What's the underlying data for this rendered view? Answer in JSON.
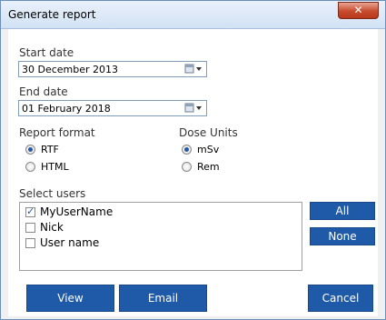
{
  "window": {
    "title": "Generate report",
    "close_icon": "close-icon"
  },
  "start_date": {
    "label": "Start date",
    "value": "30 December 2013"
  },
  "end_date": {
    "label": "End date",
    "value": "01  February  2018"
  },
  "report_format": {
    "label": "Report format",
    "options": [
      {
        "label": "RTF",
        "selected": true
      },
      {
        "label": "HTML",
        "selected": false
      }
    ]
  },
  "dose_units": {
    "label": "Dose Units",
    "options": [
      {
        "label": "mSv",
        "selected": true
      },
      {
        "label": "Rem",
        "selected": false
      }
    ]
  },
  "select_users": {
    "label": "Select users",
    "users": [
      {
        "name": "MyUserName",
        "checked": true
      },
      {
        "name": "Nick",
        "checked": false
      },
      {
        "name": "User name",
        "checked": false
      }
    ],
    "all_label": "All",
    "none_label": "None"
  },
  "actions": {
    "view_label": "View",
    "email_label": "Email",
    "cancel_label": "Cancel"
  },
  "colors": {
    "accent": "#1f5aa8",
    "close": "#c74b2d"
  }
}
